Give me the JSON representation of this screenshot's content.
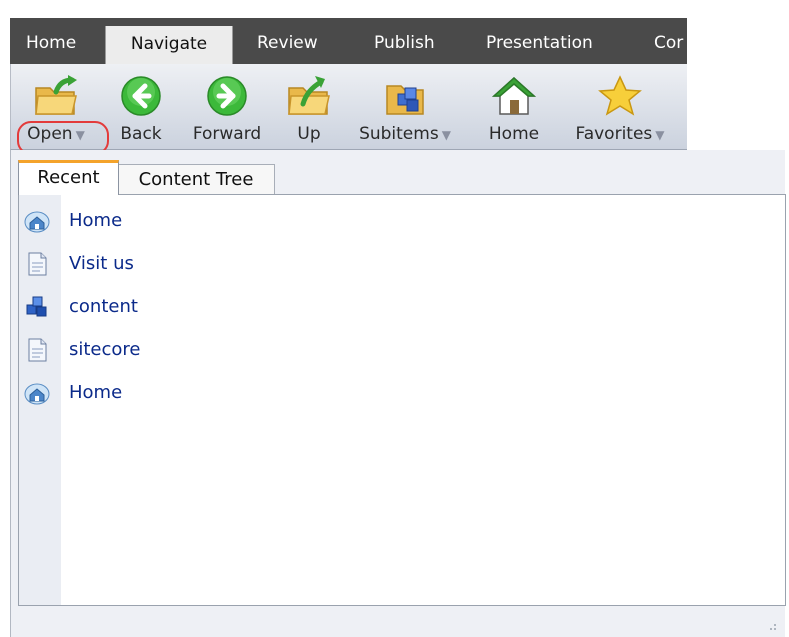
{
  "tabs": [
    {
      "label": "Home",
      "active": false
    },
    {
      "label": "Navigate",
      "active": true
    },
    {
      "label": "Review",
      "active": false
    },
    {
      "label": "Publish",
      "active": false
    },
    {
      "label": "Presentation",
      "active": false
    },
    {
      "label": "Cor",
      "active": false
    }
  ],
  "ribbon": {
    "buttons": [
      {
        "label": "Open",
        "icon": "folder-open-icon",
        "dropdown": true
      },
      {
        "label": "Back",
        "icon": "arrow-left-icon",
        "dropdown": false
      },
      {
        "label": "Forward",
        "icon": "arrow-right-icon",
        "dropdown": false
      },
      {
        "label": "Up",
        "icon": "folder-up-icon",
        "dropdown": false
      },
      {
        "label": "Subitems",
        "icon": "subitems-folder-icon",
        "dropdown": true
      },
      {
        "label": "Home",
        "icon": "home-icon",
        "dropdown": false
      },
      {
        "label": "Favorites",
        "icon": "star-icon",
        "dropdown": true
      }
    ]
  },
  "panel": {
    "tabs": [
      {
        "label": "Recent",
        "active": true
      },
      {
        "label": "Content Tree",
        "active": false
      }
    ],
    "items": [
      {
        "label": "Home",
        "icon": "home-page-icon"
      },
      {
        "label": "Visit us",
        "icon": "document-icon"
      },
      {
        "label": "content",
        "icon": "content-cubes-icon"
      },
      {
        "label": "sitecore",
        "icon": "document-icon"
      },
      {
        "label": "Home",
        "icon": "home-page-icon"
      }
    ]
  },
  "colors": {
    "tab_strip_bg": "#4a4a4a",
    "active_tab_bg": "#ececec",
    "link_text": "#0b2a8a",
    "highlight_circle": "#e33b3b",
    "active_subtab_accent": "#f4a32b"
  }
}
